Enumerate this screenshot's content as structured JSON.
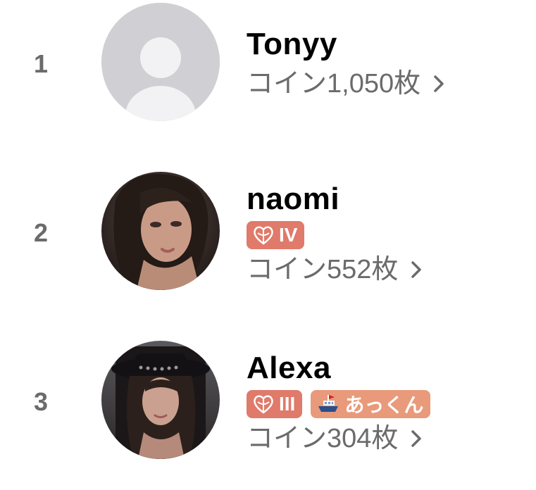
{
  "colors": {
    "rank_text": "#6b6b6b",
    "coin_text": "#6b6b6b",
    "badge_salmon": "#e07a6a",
    "badge_peach": "#e89a7a",
    "placeholder_avatar_bg": "#cfcfd3"
  },
  "ranking": [
    {
      "rank": "1",
      "name": "Tonyy",
      "avatar": "placeholder-avatar",
      "badges": [],
      "coins": "コイン1,050枚"
    },
    {
      "rank": "2",
      "name": "naomi",
      "avatar": "user-photo",
      "badges": [
        {
          "icon": "heart-emblem-icon",
          "label": "IV"
        }
      ],
      "coins": "コイン552枚"
    },
    {
      "rank": "3",
      "name": "Alexa",
      "avatar": "user-photo",
      "badges": [
        {
          "icon": "heart-emblem-icon",
          "label": "III"
        },
        {
          "icon": "ship-icon",
          "label": "あっくん"
        }
      ],
      "coins": "コイン304枚"
    }
  ]
}
